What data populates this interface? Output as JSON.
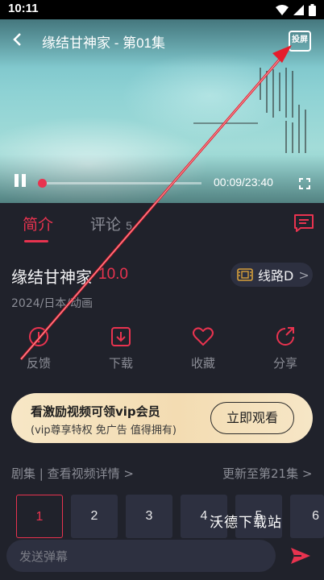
{
  "status_bar": {
    "time": "10:11"
  },
  "player": {
    "title": "缘结甘神家 - 第01集",
    "cast_label": "投屏",
    "time_display": "00:09/23:40",
    "progress_fraction": 0.007
  },
  "tabs": [
    {
      "label": "简介",
      "active": true
    },
    {
      "label": "评论",
      "count": "5"
    }
  ],
  "info": {
    "title": "缘结甘神家",
    "rating": "10.0",
    "route": "线路D",
    "meta": "2024/日本/动画"
  },
  "actions": [
    {
      "label": "反馈",
      "icon": "feedback-icon"
    },
    {
      "label": "下载",
      "icon": "download-icon"
    },
    {
      "label": "收藏",
      "icon": "heart-icon"
    },
    {
      "label": "分享",
      "icon": "share-icon"
    }
  ],
  "vip": {
    "title": "看激励视频可领vip会员",
    "subtitle": "(vip尊享特权 免广告 值得拥有)",
    "button": "立即观看"
  },
  "episodes": {
    "header_left": "剧集 | 查看视频详情",
    "header_right": "更新至第21集",
    "list": [
      "1",
      "2",
      "3",
      "4",
      "5",
      "6"
    ]
  },
  "watermark": "沃德下载站",
  "danmaku": {
    "placeholder": "发送弹幕"
  },
  "colors": {
    "accent": "#e8334f",
    "background": "#20222b",
    "vip_gold": "#f3dcb2"
  }
}
